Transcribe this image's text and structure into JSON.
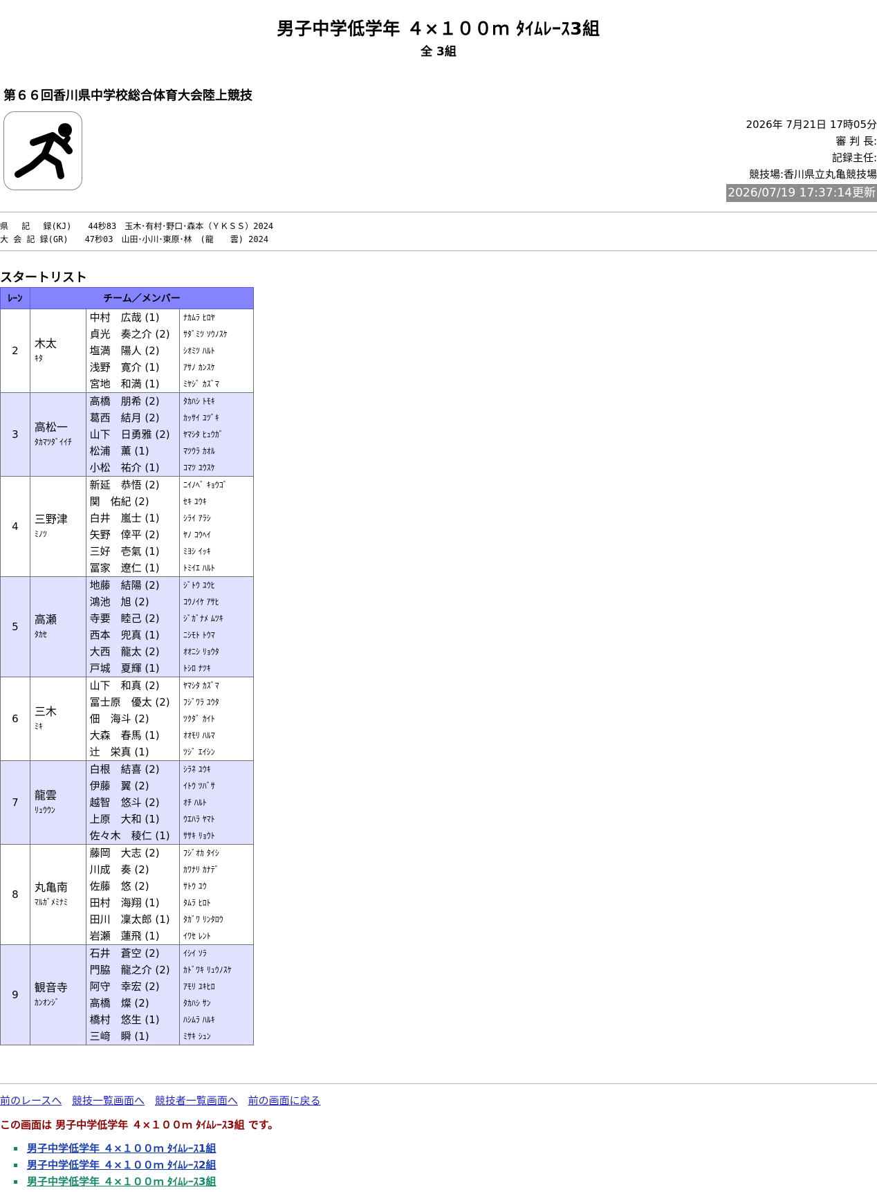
{
  "title": "男子中学低学年 ４×１００ｍ ﾀｲﾑﾚｰｽ3組",
  "subtitle": "全 3組",
  "meet_name": "第６６回香川県中学校総合体育大会陸上競技",
  "logo_icon": "sprinter-icon",
  "info": {
    "datetime": "2026年 7月21日 17時05分",
    "referee": "審 判 長:",
    "recorder": "記録主任:",
    "venue": "競技場:香川県立丸亀競技場",
    "updated": "2026/07/19 17:37:14更新"
  },
  "records": {
    "kj": "県　 記 　録(KJ)　　44秒83　玉木･有村･野口･森本（ＹＫＳＳ）2024",
    "gr": "大 会 記 録(GR)　　47秒03　山田･小川･東原･林　(龍　　雲) 2024"
  },
  "section_title": "スタートリスト",
  "table": {
    "col_lane": "ﾚｰﾝ",
    "col_team": "チーム／メンバー",
    "rows": [
      {
        "lane": "2",
        "team": "木太",
        "team_kana": "ｷﾀ",
        "members": [
          "中村　広哉 (1)",
          "貞光　奏之介 (2)",
          "塩満　陽人 (2)",
          "浅野　寛介 (1)",
          "宮地　和満 (1)"
        ],
        "kanas": [
          "ﾅｶﾑﾗ ﾋﾛﾔ",
          "ｻﾀﾞﾐﾂ ｿｳﾉｽｹ",
          "ｼｵﾐﾂ ﾊﾙﾄ",
          "ｱｻﾉ ｶﾝｽｹ",
          "ﾐﾔｼﾞ ｶｽﾞﾏ"
        ]
      },
      {
        "lane": "3",
        "team": "高松一",
        "team_kana": "ﾀｶﾏﾂﾀﾞｲｲﾁ",
        "members": [
          "高橋　朋希 (2)",
          "葛西　結月 (2)",
          "山下　日勇雅 (2)",
          "松浦　薫 (1)",
          "小松　祐介 (1)"
        ],
        "kanas": [
          "ﾀｶﾊｼ ﾄﾓｷ",
          "ｶｯｻｲ ﾕﾂﾞｷ",
          "ﾔﾏｼﾀ ﾋｭｳｶﾞ",
          "ﾏﾂｳﾗ ｶｵﾙ",
          "ｺﾏﾂ ﾕｳｽｹ"
        ]
      },
      {
        "lane": "4",
        "team": "三野津",
        "team_kana": "ﾐﾉﾂ",
        "members": [
          "新延　恭悟 (2)",
          "関　佑紀 (2)",
          "白井　嵐士 (1)",
          "矢野　倖平 (2)",
          "三好　壱氣 (1)",
          "冨家　遼仁 (1)"
        ],
        "kanas": [
          "ﾆｲﾉﾍﾞ ｷｮｳｺﾞ",
          "ｾｷ ﾕｳｷ",
          "ｼﾗｲ ｱﾗｼ",
          "ﾔﾉ ｺｳﾍｲ",
          "ﾐﾖｼ ｲｯｷ",
          "ﾄﾐｲｴ ﾊﾙﾄ"
        ]
      },
      {
        "lane": "5",
        "team": "高瀬",
        "team_kana": "ﾀｶｾ",
        "members": [
          "地藤　結陽 (2)",
          "鴻池　旭 (2)",
          "寺要　睦己 (2)",
          "西本　兜真 (1)",
          "大西　龍太 (2)",
          "戸城　夏輝 (1)"
        ],
        "kanas": [
          "ｼﾞﾄｳ ﾕｳﾋ",
          "ｺｳﾉｲｹ ｱｻﾋ",
          "ｼﾞｶﾞﾅﾒ ﾑﾂｷ",
          "ﾆｼﾓﾄ ﾄｳﾏ",
          "ｵｵﾆｼ ﾘｮｳﾀ",
          "ﾄｼﾛ ﾅﾂｷ"
        ]
      },
      {
        "lane": "6",
        "team": "三木",
        "team_kana": "ﾐｷ",
        "members": [
          "山下　和真 (2)",
          "冨士原　優太 (2)",
          "佃　海斗 (2)",
          "大森　春馬 (1)",
          "辻　栄真 (1)"
        ],
        "kanas": [
          "ﾔﾏｼﾀ ｶｽﾞﾏ",
          "ﾌｼﾞﾜﾗ ﾕｳﾀ",
          "ﾂｸﾀﾞ ｶｲﾄ",
          "ｵｵﾓﾘ ﾊﾙﾏ",
          "ﾂｼﾞ ｴｲｼﾝ"
        ]
      },
      {
        "lane": "7",
        "team": "龍雲",
        "team_kana": "ﾘｭｳｳﾝ",
        "members": [
          "白根　結喜 (2)",
          "伊藤　翼 (2)",
          "越智　悠斗 (2)",
          "上原　大和 (1)",
          "佐々木　稜仁 (1)"
        ],
        "kanas": [
          "ｼﾗﾈ ﾕｳｷ",
          "ｲﾄｳ ﾂﾊﾞｻ",
          "ｵﾁ ﾊﾙﾄ",
          "ｳｴﾊﾗ ﾔﾏﾄ",
          "ｻｻｷ ﾘｮｳﾄ"
        ]
      },
      {
        "lane": "8",
        "team": "丸亀南",
        "team_kana": "ﾏﾙｶﾞﾒﾐﾅﾐ",
        "members": [
          "藤岡　大志 (2)",
          "川成　奏 (2)",
          "佐藤　悠 (2)",
          "田村　海翔 (1)",
          "田川　凜太郎 (1)",
          "岩瀬　蓮飛 (1)"
        ],
        "kanas": [
          "ﾌｼﾞｵｶ ﾀｲｼ",
          "ｶﾜﾅﾘ ｶﾅﾃﾞ",
          "ｻﾄｳ ﾕｳ",
          "ﾀﾑﾗ ﾋﾛﾄ",
          "ﾀｶﾞﾜ ﾘﾝﾀﾛｳ",
          "ｲﾜｾ ﾚﾝﾄ"
        ]
      },
      {
        "lane": "9",
        "team": "観音寺",
        "team_kana": "ｶﾝｵﾝｼﾞ",
        "members": [
          "石井　蒼空 (2)",
          "門脇　龍之介 (2)",
          "阿守　幸宏 (2)",
          "高橋　燦 (2)",
          "橋村　悠生 (1)",
          "三﨑　瞬 (1)"
        ],
        "kanas": [
          "ｲｼｲ ｿﾗ",
          "ｶﾄﾞﾜｷ ﾘｭｳﾉｽｹ",
          "ｱﾓﾘ ﾕｷﾋﾛ",
          "ﾀｶﾊｼ ｻﾝ",
          "ﾊｼﾑﾗ ﾊﾙｷ",
          "ﾐｻｷ ｼｭﾝ"
        ]
      }
    ]
  },
  "nav": {
    "prev_race": "前のレースへ",
    "event_list": "競技一覧画面へ",
    "athlete_list": "競技者一覧画面へ",
    "back": "前の画面に戻る"
  },
  "current_notice": "この画面は 男子中学低学年 ４×１００ｍ ﾀｲﾑﾚｰｽ3組 です。",
  "heats": [
    "男子中学低学年 ４×１００ｍ ﾀｲﾑﾚｰｽ1組",
    "男子中学低学年 ４×１００ｍ ﾀｲﾑﾚｰｽ2組",
    "男子中学低学年 ４×１００ｍ ﾀｲﾑﾚｰｽ3組"
  ],
  "colors": {
    "header_bg": "#8484ff",
    "row_alt_bg": "#e0e0ff",
    "updated_bg": "#8c8c8c",
    "notice": "#8b0000",
    "current_heat": "#118866"
  }
}
